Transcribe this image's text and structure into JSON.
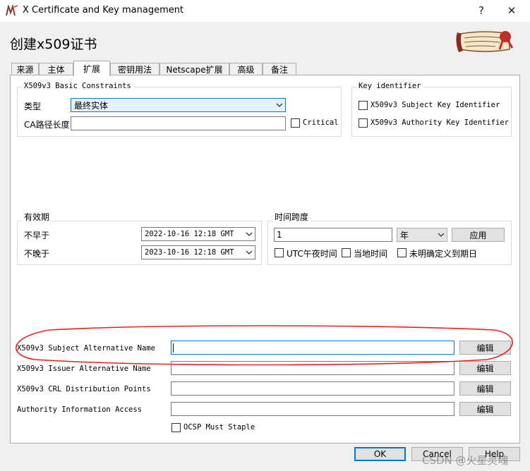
{
  "window": {
    "title": "X Certificate and Key management",
    "help_glyph": "?",
    "close_glyph": "✕"
  },
  "dialog": {
    "title": "创建x509证书"
  },
  "tabs": [
    {
      "label": "来源"
    },
    {
      "label": "主体"
    },
    {
      "label": "扩展",
      "active": true
    },
    {
      "label": "密钥用法"
    },
    {
      "label": "Netscape扩展"
    },
    {
      "label": "高级"
    },
    {
      "label": "备注"
    }
  ],
  "basic_constraints": {
    "title": "X509v3 Basic Constraints",
    "type_label": "类型",
    "type_value": "最终实体",
    "ca_path_label": "CA路径长度",
    "ca_path_value": "",
    "critical_label": "Critical"
  },
  "key_identifier": {
    "title": "Key identifier",
    "subject_key_label": "X509v3 Subject Key Identifier",
    "authority_key_label": "X509v3 Authority Key Identifier"
  },
  "validity": {
    "title": "有效期",
    "not_before_label": "不早于",
    "not_before_value": "2022-10-16 12:18 GMT",
    "not_after_label": "不晚于",
    "not_after_value": "2023-10-16 12:18 GMT"
  },
  "time_range": {
    "title": "时间跨度",
    "amount_value": "1",
    "unit_value": "年",
    "apply_label": "应用",
    "utc_label": "UTC午夜时间",
    "local_label": "当地时间",
    "undefined_label": "未明确定义到期日"
  },
  "extensions": {
    "san_label": "X509v3 Subject Alternative Name",
    "ian_label": "X509v3 Issuer Alternative Name",
    "crl_label": "X509v3 CRL Distribution Points",
    "aia_label": "Authority Information Access",
    "edit_label": "编辑",
    "ocsp_label": "OCSP Must Staple"
  },
  "footer": {
    "ok_label": "OK",
    "cancel_label": "Cancel",
    "help_label": "Help",
    "watermark": "CSDN @火星灵魂"
  },
  "colors": {
    "accent": "#0078d7",
    "annotation": "#e8231f"
  }
}
